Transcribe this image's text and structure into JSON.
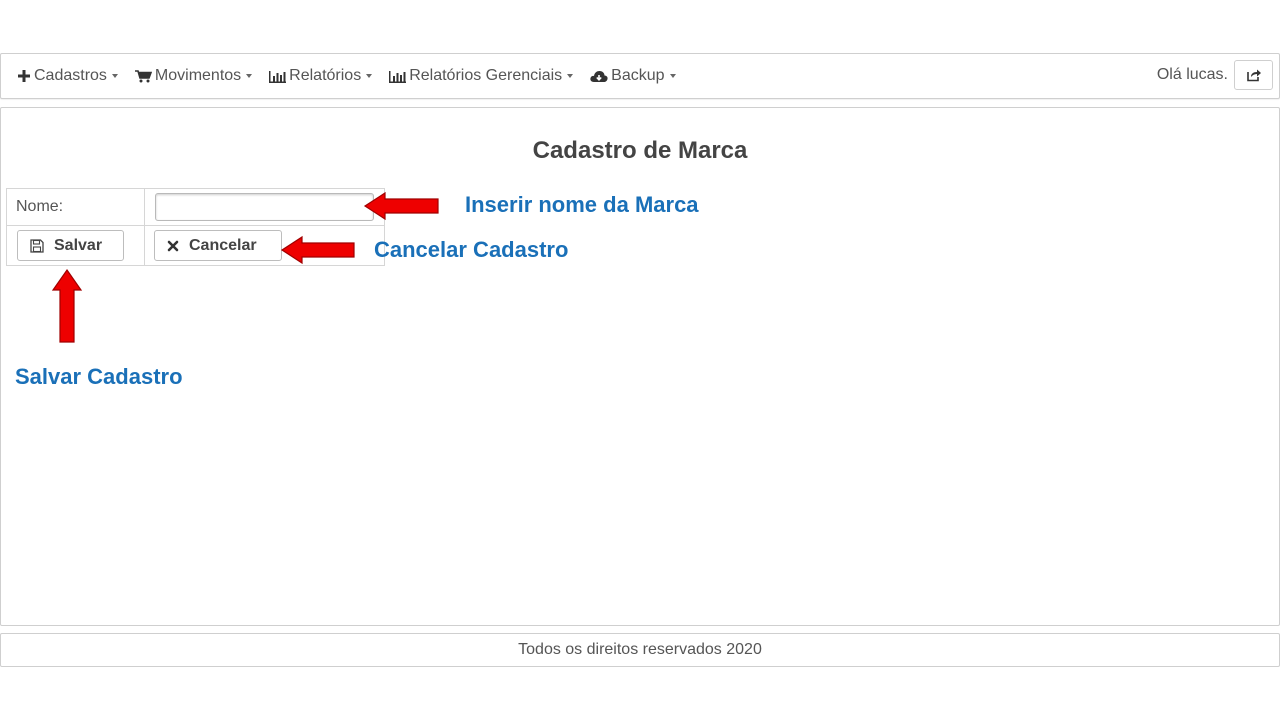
{
  "navbar": {
    "items": [
      {
        "label": "Cadastros",
        "icon": "plus-icon"
      },
      {
        "label": "Movimentos",
        "icon": "cart-icon"
      },
      {
        "label": "Relatórios",
        "icon": "bar-chart-icon"
      },
      {
        "label": "Relatórios Gerenciais",
        "icon": "bar-chart-icon"
      },
      {
        "label": "Backup",
        "icon": "cloud-download-icon"
      }
    ],
    "greeting": "Olá lucas.",
    "logout_icon": "share-icon"
  },
  "main": {
    "title": "Cadastro de Marca",
    "form": {
      "name_label": "Nome:",
      "name_value": "",
      "save_label": "Salvar",
      "cancel_label": "Cancelar"
    }
  },
  "annotations": {
    "insert_name": "Inserir nome da Marca",
    "cancel": "Cancelar Cadastro",
    "save": "Salvar Cadastro",
    "color": "#1a70b8",
    "arrow_color": "#ee0000"
  },
  "footer": {
    "text": "Todos os direitos reservados 2020"
  }
}
